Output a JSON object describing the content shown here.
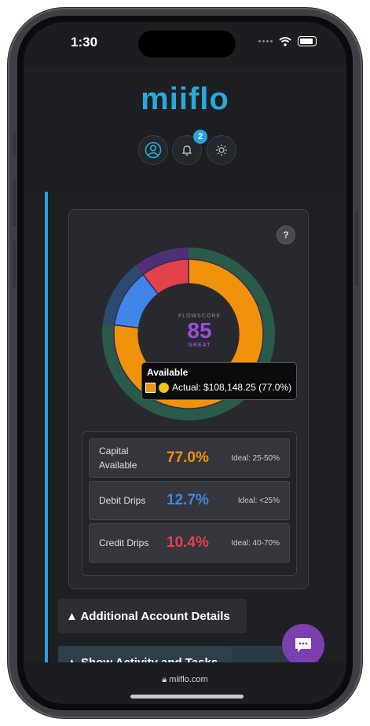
{
  "status_bar": {
    "time": "1:30"
  },
  "header": {
    "logo": "miiflo",
    "notifications_count": "2",
    "icons": [
      "user-icon",
      "bell-icon",
      "sun-icon"
    ]
  },
  "flowscore": {
    "label": "FLOWSCORE",
    "score": "85",
    "rating": "GREAT",
    "help": "?"
  },
  "tooltip": {
    "title": "Available",
    "text": "Actual: $108,148.25 (77.0%)"
  },
  "chart_data": {
    "type": "pie",
    "categories": [
      "Capital Available",
      "Debit Drips",
      "Credit Drips"
    ],
    "values": [
      77.0,
      12.7,
      10.4
    ],
    "colors": [
      "#f0930a",
      "#3f86e8",
      "#e2434a"
    ],
    "outer_ring": {
      "colors": [
        "#2a5a4a",
        "#2a4a72",
        "#4f2f75"
      ]
    },
    "title": "",
    "xlabel": "",
    "ylabel": ""
  },
  "stats": [
    {
      "label": "Capital Available",
      "value": "77.0%",
      "ideal": "Ideal: 25-50%",
      "color": "#f0930a"
    },
    {
      "label": "Debit Drips",
      "value": "12.7%",
      "ideal": "Ideal: <25%",
      "color": "#3f86e8"
    },
    {
      "label": "Credit Drips",
      "value": "10.4%",
      "ideal": "Ideal: 40-70%",
      "color": "#e2434a"
    }
  ],
  "buttons": {
    "additional": "▲ Additional Account Details",
    "activity": "▲ Show Activity and Tasks"
  },
  "browser": {
    "url": "miiflo.com"
  }
}
